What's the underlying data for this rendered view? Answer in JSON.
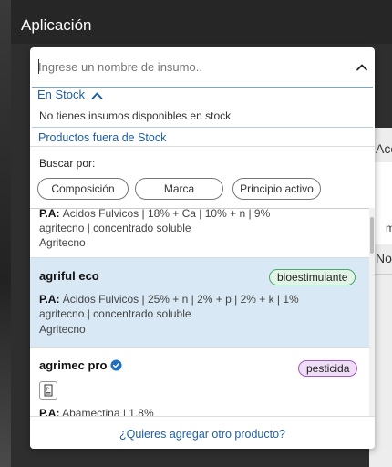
{
  "app": {
    "title": "Aplicación"
  },
  "search": {
    "placeholder": "Ingrese un nombre de insumo.."
  },
  "stock": {
    "header": "En Stock",
    "empty_message": "No tienes insumos disponibles en stock"
  },
  "out_of_stock": {
    "header": "Productos fuera de Stock"
  },
  "filter": {
    "label": "Buscar por:",
    "options": [
      "Composición",
      "Marca",
      "Principio activo"
    ]
  },
  "items": [
    {
      "name": "",
      "pa_label": "P.A:",
      "pa": "Ácidos Fulvicos | 18% + Ca | 10% + n | 9%",
      "details": "agritecno | concentrado soluble",
      "brand": "Agritecno"
    },
    {
      "name": "agriful eco",
      "badge": "bioestimulante",
      "pa_label": "P.A:",
      "pa": "Ácidos Fulvicos | 25% + n | 2% + p | 2% + k | 1%",
      "details": "agritecno | concentrado soluble",
      "brand": "Agritecno",
      "selected": true
    },
    {
      "name": "agrimec pro",
      "badge": "pesticida",
      "verified": true,
      "pa_label": "P.A:",
      "pa": "Abamectina | 1.8%"
    }
  ],
  "footer": {
    "link": "¿Quieres agregar otro producto?"
  },
  "behind": {
    "text1": "Acc",
    "text2": "m",
    "text3": "No"
  },
  "colors": {
    "accent": "#1f5fa3",
    "selected_row": "#d8e8f4",
    "bio_badge": "#e1f4e6",
    "pest_badge": "#efdcf6"
  },
  "icons": {
    "dropdown": "chevron-up-icon",
    "stock_header": "chevron-up-icon",
    "verified": "verified-check-icon",
    "document": "document-icon"
  }
}
